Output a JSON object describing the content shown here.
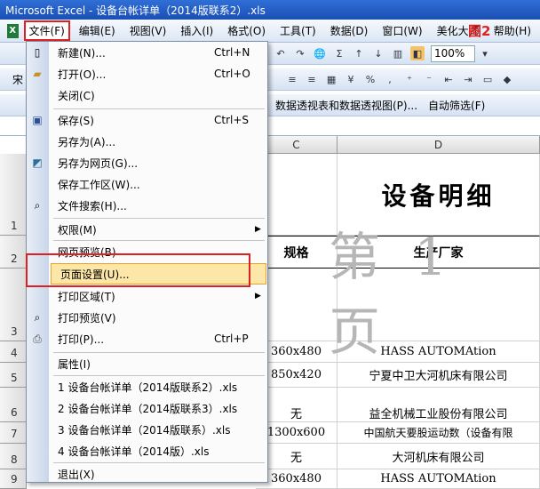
{
  "title": "Microsoft Excel - 设备台帐详单（2014版联系2）.xls",
  "figure_label": "图2",
  "menubar": [
    "文件(F)",
    "编辑(E)",
    "视图(V)",
    "插入(I)",
    "格式(O)",
    "工具(T)",
    "数据(D)",
    "窗口(W)",
    "美化大师",
    "帮助(H)"
  ],
  "toolbar": {
    "zoom": "100%",
    "font_name": "宋",
    "pivot": "数据透视表和数据透视图(P)...",
    "autofilter": "自动筛选(F)"
  },
  "columns": {
    "c": "C",
    "d": "D"
  },
  "rows": [
    "1",
    "2",
    "3",
    "4",
    "5",
    "6",
    "7",
    "8",
    "9"
  ],
  "sheet": {
    "title": "设备明细",
    "header_spec": "规格",
    "header_maker": "生产厂家",
    "r4_spec": "360x480",
    "r4_maker": "HASS  AUTOMAtion",
    "r5_spec": "850x420",
    "r5_maker": "宁夏中卫大河机床有限公司",
    "r6_spec": "无",
    "r6_maker": "益全机械工业股份有限公司",
    "r7_spec": "1300x600",
    "r7_maker": "中国航天要股运动数（设备有限",
    "r8_spec": "无",
    "r8_maker": "大河机床有限公司",
    "r9_spec": "360x480",
    "r9_maker": "HASS  AUTOMAtion",
    "watermark": "第 1 页"
  },
  "file_menu": {
    "new": "新建(N)...",
    "new_sc": "Ctrl+N",
    "open": "打开(O)...",
    "open_sc": "Ctrl+O",
    "close": "关闭(C)",
    "save": "保存(S)",
    "save_sc": "Ctrl+S",
    "save_as": "另存为(A)...",
    "save_web": "另存为网页(G)...",
    "save_workspace": "保存工作区(W)...",
    "file_search": "文件搜索(H)...",
    "permission": "权限(M)",
    "web_preview": "网页预览(B)",
    "page_setup": "页面设置(U)...",
    "print_area": "打印区域(T)",
    "print_preview": "打印预览(V)",
    "print": "打印(P)...",
    "print_sc": "Ctrl+P",
    "properties": "属性(I)",
    "recent1": "1 设备台帐详单（2014版联系2）.xls",
    "recent2": "2 设备台帐详单（2014版联系3）.xls",
    "recent3": "3 设备台帐详单（2014版联系）.xls",
    "recent4": "4 设备台帐详单（2014版）.xls",
    "exit": "退出(X)"
  }
}
